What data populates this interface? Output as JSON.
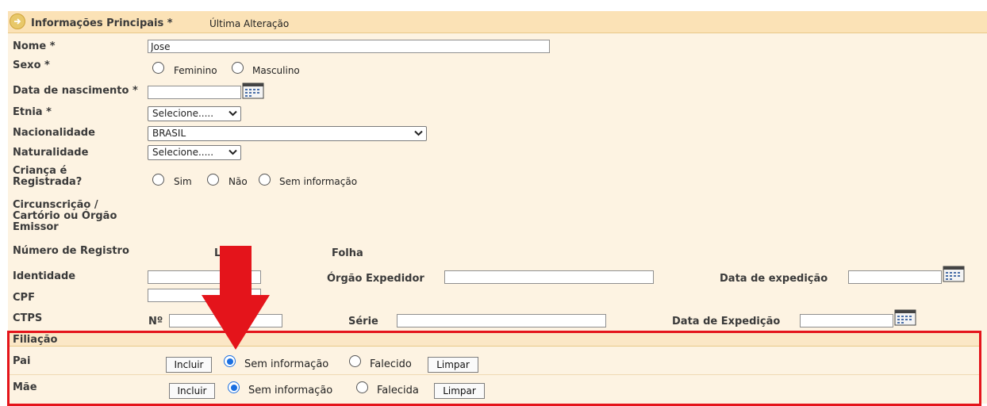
{
  "header": {
    "title": "Informações Principais *",
    "last_change": "Última Alteração"
  },
  "fields": {
    "nome_label": "Nome *",
    "nome_value": "Jose",
    "sexo_label": "Sexo *",
    "sexo_opt1": "Feminino",
    "sexo_opt2": "Masculino",
    "nasc_label": "Data de nascimento *",
    "etnia_label": "Etnia *",
    "etnia_value": "Selecione.....",
    "nac_label": "Nacionalidade",
    "nac_value": "BRASIL",
    "nat_label": "Naturalidade",
    "nat_value": "Selecione.....",
    "crianca_label_1": "Criança é",
    "crianca_label_2": "Registrada?",
    "crianca_opt1": "Sim",
    "crianca_opt2": "Não",
    "crianca_opt3": "Sem informação",
    "circ_label_1": "Circunscrição /",
    "circ_label_2": "Cartório ou Órgão",
    "circ_label_3": "Emissor",
    "numreg_label": "Número de Registro",
    "livro_label": "L",
    "folha_label": "Folha",
    "ident_label": "Identidade",
    "orgao_label": "Órgão Expedidor",
    "dataexp_label": "Data de expedição",
    "cpf_label": "CPF",
    "ctps_label": "CTPS",
    "no_label": "Nº",
    "serie_label": "Série",
    "dataexp2_label": "Data de Expedição"
  },
  "filiacao": {
    "title": "Filiação",
    "pai": {
      "label": "Pai",
      "include": "Incluir",
      "opt1": "Sem informação",
      "opt2": "Falecido",
      "clear": "Limpar",
      "selected": "Sem informação"
    },
    "mae": {
      "label": "Mãe",
      "include": "Incluir",
      "opt1": "Sem informação",
      "opt2": "Falecida",
      "clear": "Limpar",
      "selected": "Sem informação"
    }
  },
  "colors": {
    "header_bg": "#fbe2b6",
    "panel_bg": "#fdf3e2",
    "highlight": "#e4141b",
    "radio_selected": "#1a6fe0"
  },
  "icons": [
    "arrow-circle-icon",
    "calendar-icon",
    "chevron-down-icon",
    "red-down-arrow-icon"
  ]
}
